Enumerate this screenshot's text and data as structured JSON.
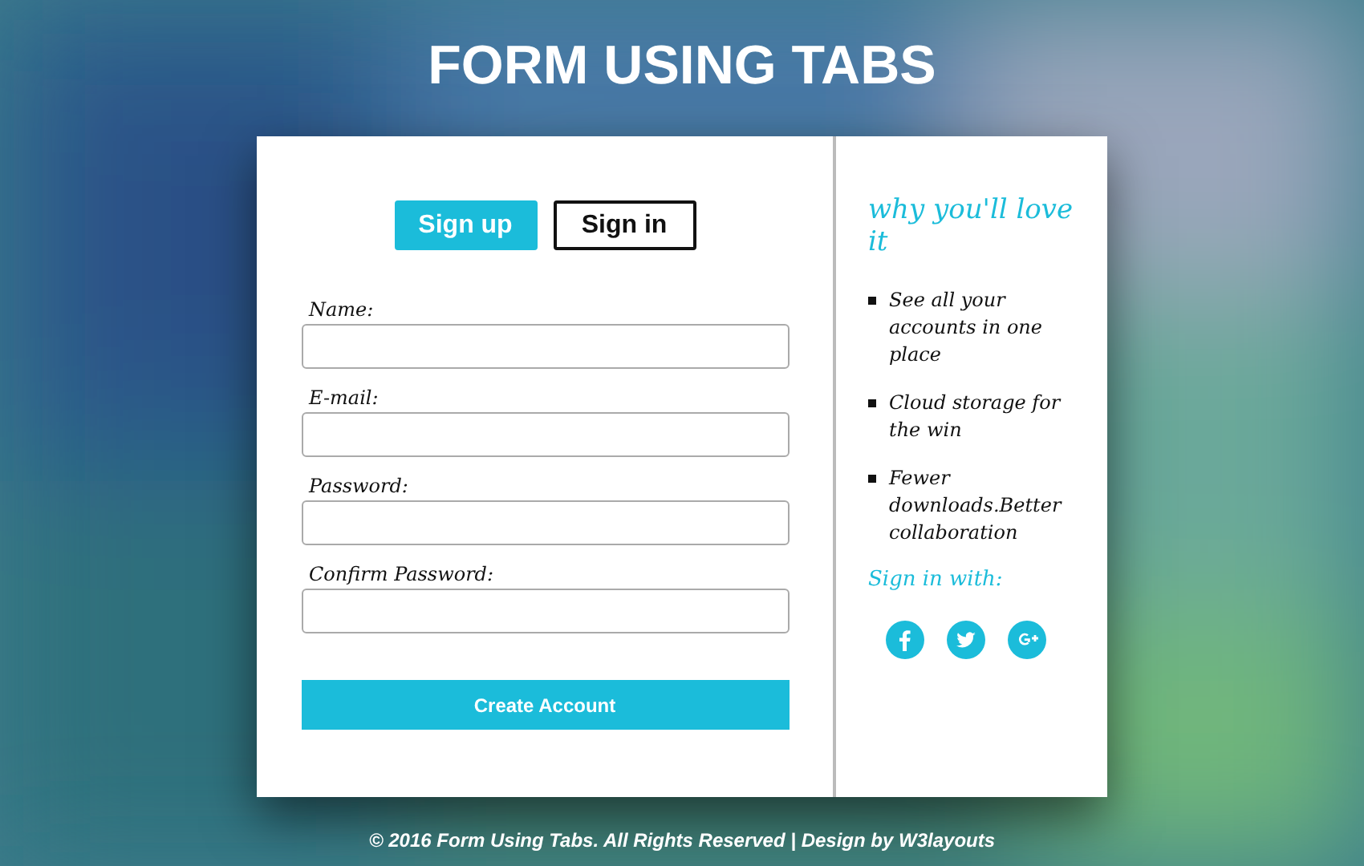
{
  "title": "FORM USING TABS",
  "tabs": [
    {
      "label": "Sign up",
      "selected": true
    },
    {
      "label": "Sign in",
      "selected": false
    }
  ],
  "fields": [
    {
      "label": "Name:"
    },
    {
      "label": "E-mail:"
    },
    {
      "label": "Password:"
    },
    {
      "label": "Confirm Password:"
    }
  ],
  "submit": "Create Account",
  "aside": {
    "heading": "why you'll love it",
    "points": [
      "See all your accounts in one place",
      "Cloud storage for the win",
      "Fewer downloads.Better collaboration"
    ],
    "social_label": "Sign in with:",
    "social": [
      {
        "kind": "facebook"
      },
      {
        "kind": "twitter"
      },
      {
        "kind": "google"
      }
    ]
  },
  "footer": "© 2016 Form Using Tabs. All Rights Reserved | Design by W3layouts"
}
